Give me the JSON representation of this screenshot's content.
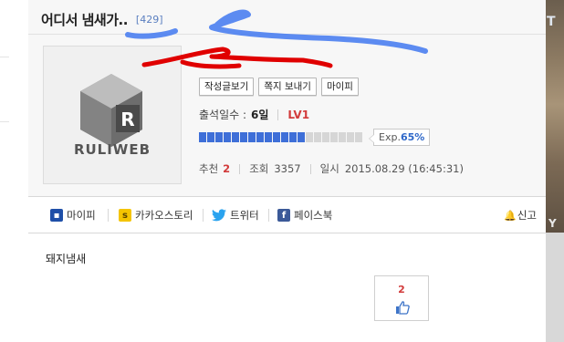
{
  "post": {
    "title": "어디서 냄새가..",
    "reply_count": "[429]",
    "profile": {
      "logo_text": "RULIWEB",
      "buttons": [
        "작성글보기",
        "쪽지 보내기",
        "마이피"
      ],
      "attendance_label": "출석일수 :",
      "attendance_days": "6일",
      "level": "LV1",
      "exp_label": "Exp.",
      "exp_percent": "65%",
      "exp_progress": 0.65
    },
    "meta": {
      "recommend_label": "추천",
      "recommend_count": "2",
      "views_label": "조회",
      "views_count": "3357",
      "date_label": "일시",
      "date_value": "2015.08.29 (16:45:31)"
    },
    "share": {
      "mypi": "마이피",
      "kakao": "카카오스토리",
      "twitter": "트위터",
      "facebook": "페이스북",
      "report": "신고"
    },
    "body": {
      "text": "돼지냄새",
      "likes": "2"
    }
  },
  "side_image": {
    "top_text": "T",
    "bottom_text": "Y"
  },
  "colors": {
    "accent_blue": "#3e6fd8",
    "level_red": "#d23b3b",
    "scribble_blue": "#4a7ef0",
    "scribble_red": "#e00000"
  }
}
